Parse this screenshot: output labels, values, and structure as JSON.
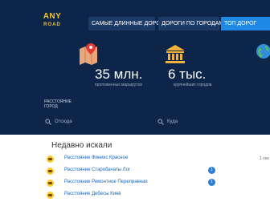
{
  "logo": {
    "line1": "ANY",
    "line2": "ROAD"
  },
  "nav": [
    {
      "label": "САМЫЕ ДЛИННЫЕ ДОРОГИ"
    },
    {
      "label": "ДОРОГИ ПО ГОРОДАМ"
    },
    {
      "label": "ТОП ДОРОГ"
    }
  ],
  "stats": [
    {
      "value": "35 млн.",
      "caption": "проложенных маршрутов",
      "icon": "map-pin-icon"
    },
    {
      "value": "6 тыс.",
      "caption": "крупнейших городов",
      "icon": "bank-building-icon"
    }
  ],
  "distance_label": [
    "РАССТОЯНИЕ",
    "ГОРОД"
  ],
  "search": {
    "from_placeholder": "Отсюда",
    "to_placeholder": "Куда"
  },
  "recent": {
    "title": "Недавно искали",
    "items": [
      {
        "text": "Расстояние Финикс Красное",
        "badge": "",
        "time": "1 сек"
      },
      {
        "text": "Расстояние Старобачаты Лог",
        "badge": "1",
        "time": ""
      },
      {
        "text": "Расстояние Ремонтное Переправная",
        "badge": "1",
        "time": ""
      },
      {
        "text": "Расстояние Дебесы Киев",
        "badge": "",
        "time": ""
      }
    ]
  },
  "colors": {
    "hero": "#0c2549",
    "accent": "#1e88e5",
    "logo": "#f3c623",
    "link": "#1565c0"
  }
}
